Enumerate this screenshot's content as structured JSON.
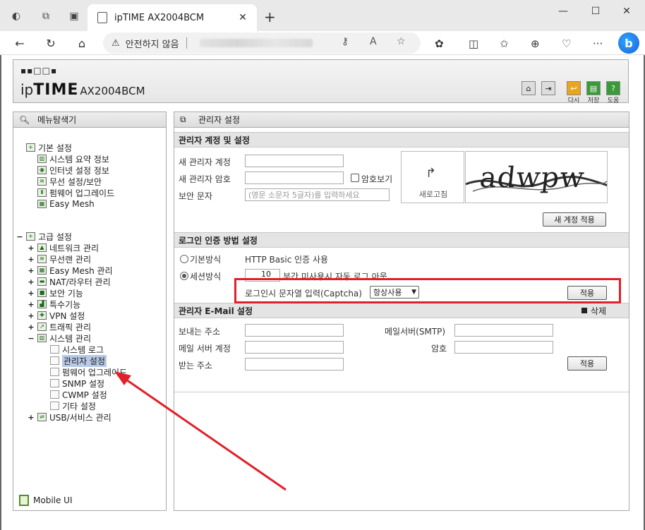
{
  "browser": {
    "tab_title": "ipTIME AX2004BCM",
    "insecure_label": "안전하지 않음"
  },
  "header": {
    "brand_ip": "ip",
    "brand_time": "TIME",
    "model": "AX2004BCM",
    "buttons": [
      {
        "label": "다시",
        "icon": "return-icon"
      },
      {
        "label": "저장",
        "icon": "save-icon"
      },
      {
        "label": "도움",
        "icon": "help-icon"
      }
    ]
  },
  "sidebar": {
    "title": "메뉴탐색기",
    "basic": {
      "label": "기본 설정",
      "items": [
        "시스템 요약 정보",
        "인터넷 설정 정보",
        "무선 설정/보안",
        "펌웨어 업그레이드",
        "Easy Mesh"
      ]
    },
    "advanced": {
      "label": "고급 설정",
      "items": [
        "네트워크 관리",
        "무선랜 관리",
        "Easy Mesh 관리",
        "NAT/라우터 관리",
        "보안 기능",
        "특수기능",
        "VPN 설정",
        "트래픽 관리",
        "시스템 관리"
      ],
      "system_children": [
        "시스템 로그",
        "관리자 설정",
        "펌웨어 업그레이드",
        "SNMP 설정",
        "CWMP 설정",
        "기타 설정"
      ],
      "last": "USB/서비스 관리"
    },
    "mobile_ui": "Mobile UI"
  },
  "main": {
    "title": "관리자 설정",
    "account": {
      "heading": "관리자 계정 및 설정",
      "new_id_label": "새 관리자 계정",
      "new_pw_label": "새 관리자 암호",
      "show_pw_label": "암호보기",
      "captcha_label": "보안 문자",
      "captcha_placeholder": "(영문 소문자 5글자)를 입력하세요",
      "refresh_label": "새로고침",
      "captcha_text": "adwpw",
      "apply_label": "새 계정 적용"
    },
    "login": {
      "heading": "로그인 인증 방법 설정",
      "basic_label": "기본방식",
      "basic_desc": "HTTP Basic 인증 사용",
      "session_label": "세션방식",
      "session_minutes": "10",
      "session_desc": "분간 미사용시 자동 로그 아웃",
      "captcha_input_label": "로그인시 문자열 입력(Captcha)",
      "captcha_mode": "항상사용",
      "apply_label": "적용"
    },
    "email": {
      "heading": "관리자 E-Mail 설정",
      "delete_label": "삭제",
      "sender_label": "보내는 주소",
      "smtp_label": "메일서버(SMTP)",
      "account_label": "메일 서버 계정",
      "password_label": "암호",
      "receiver_label": "받는 주소",
      "apply_label": "적용"
    }
  },
  "colors": {
    "highlight": "#e0202a",
    "selected": "#b7c9e6",
    "header_btn_yellow": "#e8a520",
    "header_btn_green": "#3a9a3a"
  }
}
